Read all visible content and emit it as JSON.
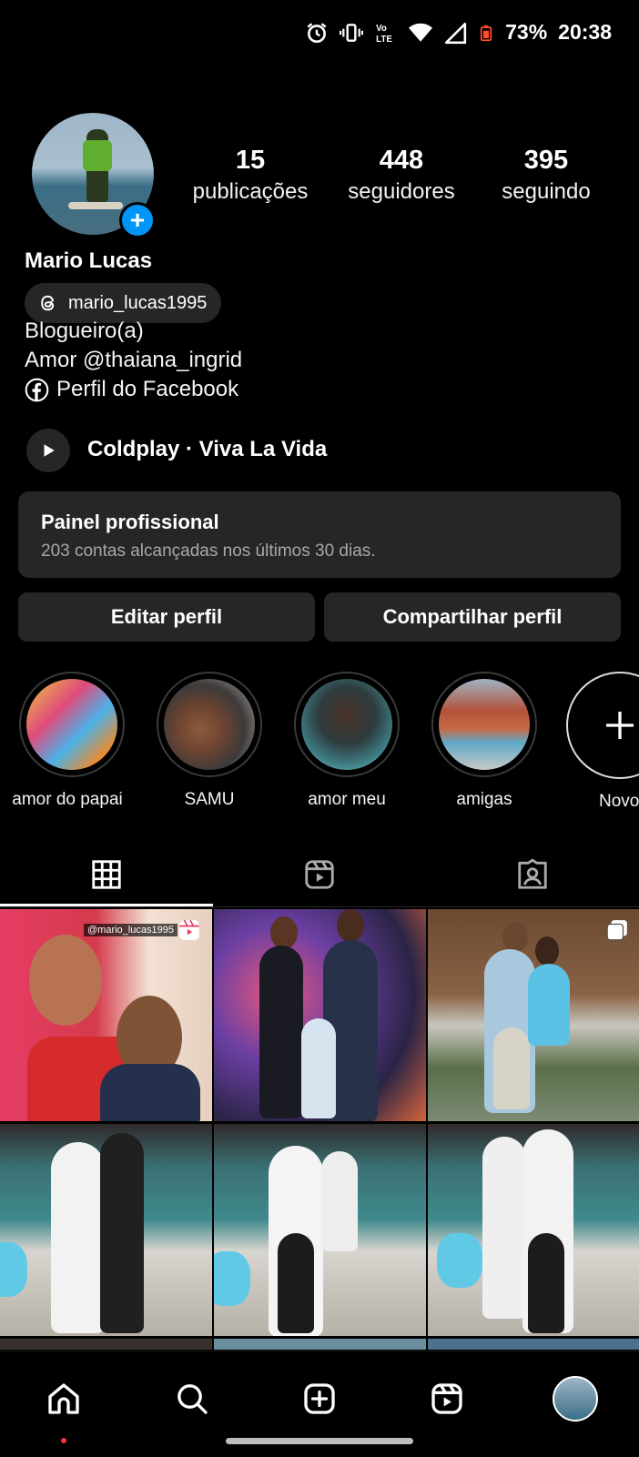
{
  "status_bar": {
    "battery": "73%",
    "time": "20:38",
    "network": "Vo⁸ LTE",
    "icons": [
      "alarm-icon",
      "vibrate-icon",
      "volte-icon",
      "wifi-icon",
      "signal-icon",
      "battery-icon"
    ]
  },
  "profile": {
    "name": "Mario Lucas",
    "threads_handle": "mario_lucas1995",
    "bio_category": "Blogueiro(a)",
    "bio_line": "Amor @thaiana_ingrid",
    "facebook_link": "Perfil do Facebook",
    "music": "Coldplay · Viva La Vida"
  },
  "stats": [
    {
      "value": "15",
      "label": "publicações"
    },
    {
      "value": "448",
      "label": "seguidores"
    },
    {
      "value": "395",
      "label": "seguindo"
    }
  ],
  "professional_panel": {
    "title": "Painel profissional",
    "subtitle": "203 contas alcançadas nos últimos 30 dias."
  },
  "buttons": {
    "edit": "Editar perfil",
    "share": "Compartilhar perfil"
  },
  "highlights": [
    {
      "label": "amor do papai"
    },
    {
      "label": "SAMU"
    },
    {
      "label": "amor meu"
    },
    {
      "label": "amigas"
    },
    {
      "label": "Novo"
    }
  ],
  "tabs": [
    "grid-icon",
    "reels-icon",
    "tagged-icon"
  ],
  "grid": {
    "first_post_overlay": "@mario_lucas1995"
  },
  "bottom_nav": [
    "home-icon",
    "search-icon",
    "create-icon",
    "reels-icon",
    "profile-avatar"
  ],
  "colors": {
    "background": "#000000",
    "surface": "#262626",
    "accent_blue": "#0095f6",
    "muted_text": "#a8a8a8",
    "notification_red": "#ff3040"
  }
}
